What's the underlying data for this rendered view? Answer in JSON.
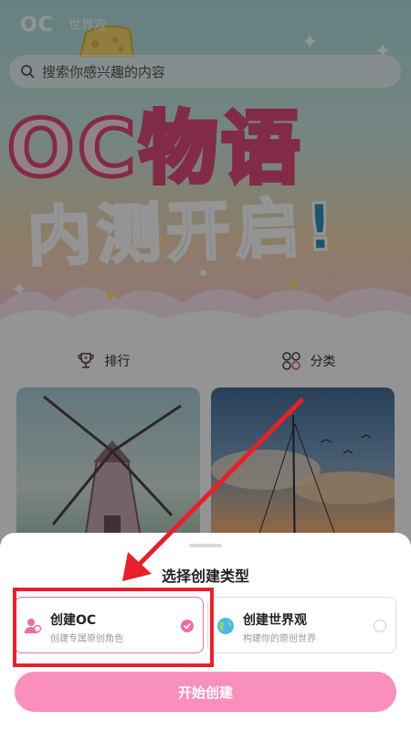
{
  "app": {
    "tab_oc": "OC",
    "tab_world": "世界观"
  },
  "search": {
    "placeholder": "搜索你感兴趣的内容"
  },
  "banner": {
    "title_line1": "OC物语",
    "title_line2": "内测开启!"
  },
  "categories": [
    {
      "label": "排行",
      "icon": "trophy-icon"
    },
    {
      "label": "分类",
      "icon": "grid-circles-icon"
    }
  ],
  "sheet": {
    "title": "选择创建类型",
    "options": [
      {
        "label": "创建OC",
        "sub": "创建专属原创角色",
        "icon": "user-pink-icon",
        "selected": true
      },
      {
        "label": "创建世界观",
        "sub": "构建你的原创世界",
        "icon": "globe-icon",
        "selected": false
      }
    ],
    "start_label": "开始创建"
  },
  "colors": {
    "accent_pink": "#f06ca1",
    "button_pink": "#f98fbc",
    "annotation_red": "#e8202a"
  }
}
